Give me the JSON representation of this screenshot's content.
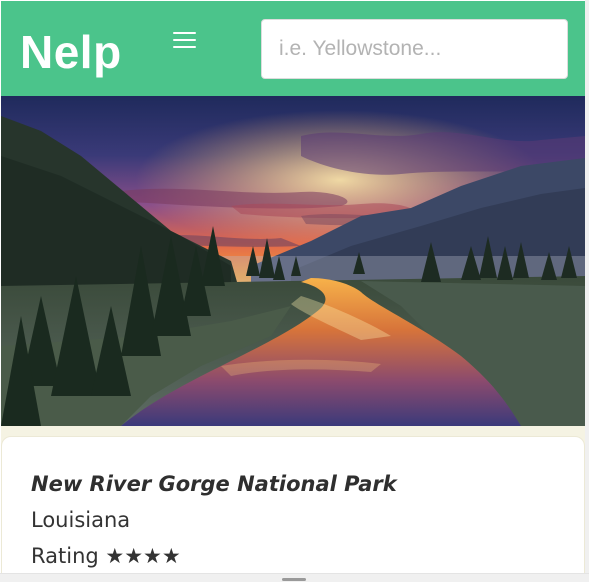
{
  "header": {
    "logo": "Nelp",
    "menu_icon": "hamburger-menu-icon",
    "search": {
      "placeholder": "i.e. Yellowstone...",
      "value": ""
    },
    "background_color": "#4bc48b"
  },
  "hero": {
    "description_icon": "landscape-photo"
  },
  "park": {
    "name": "New River Gorge National Park",
    "state": "Louisiana",
    "rating_label": "Rating",
    "rating_stars": "★★★★",
    "rating_value": 4
  }
}
